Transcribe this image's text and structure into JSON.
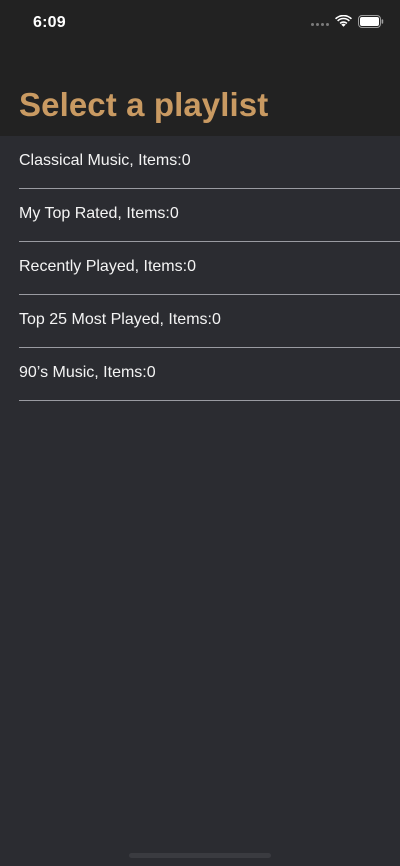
{
  "status_bar": {
    "time": "6:09"
  },
  "header": {
    "title": "Select a playlist"
  },
  "playlists": [
    {
      "label": "Classical Music, Items:0"
    },
    {
      "label": "My Top Rated, Items:0"
    },
    {
      "label": "Recently Played, Items:0"
    },
    {
      "label": "Top 25 Most Played, Items:0"
    },
    {
      "label": "90’s Music, Items:0"
    }
  ],
  "colors": {
    "background": "#2b2c31",
    "header_background": "#222222",
    "title_accent": "#c99a62",
    "separator": "#9a9ba1",
    "text": "#f4f4f4"
  },
  "icons": {
    "cellular": "cellular-signal-icon",
    "wifi": "wifi-icon",
    "battery": "battery-icon"
  }
}
